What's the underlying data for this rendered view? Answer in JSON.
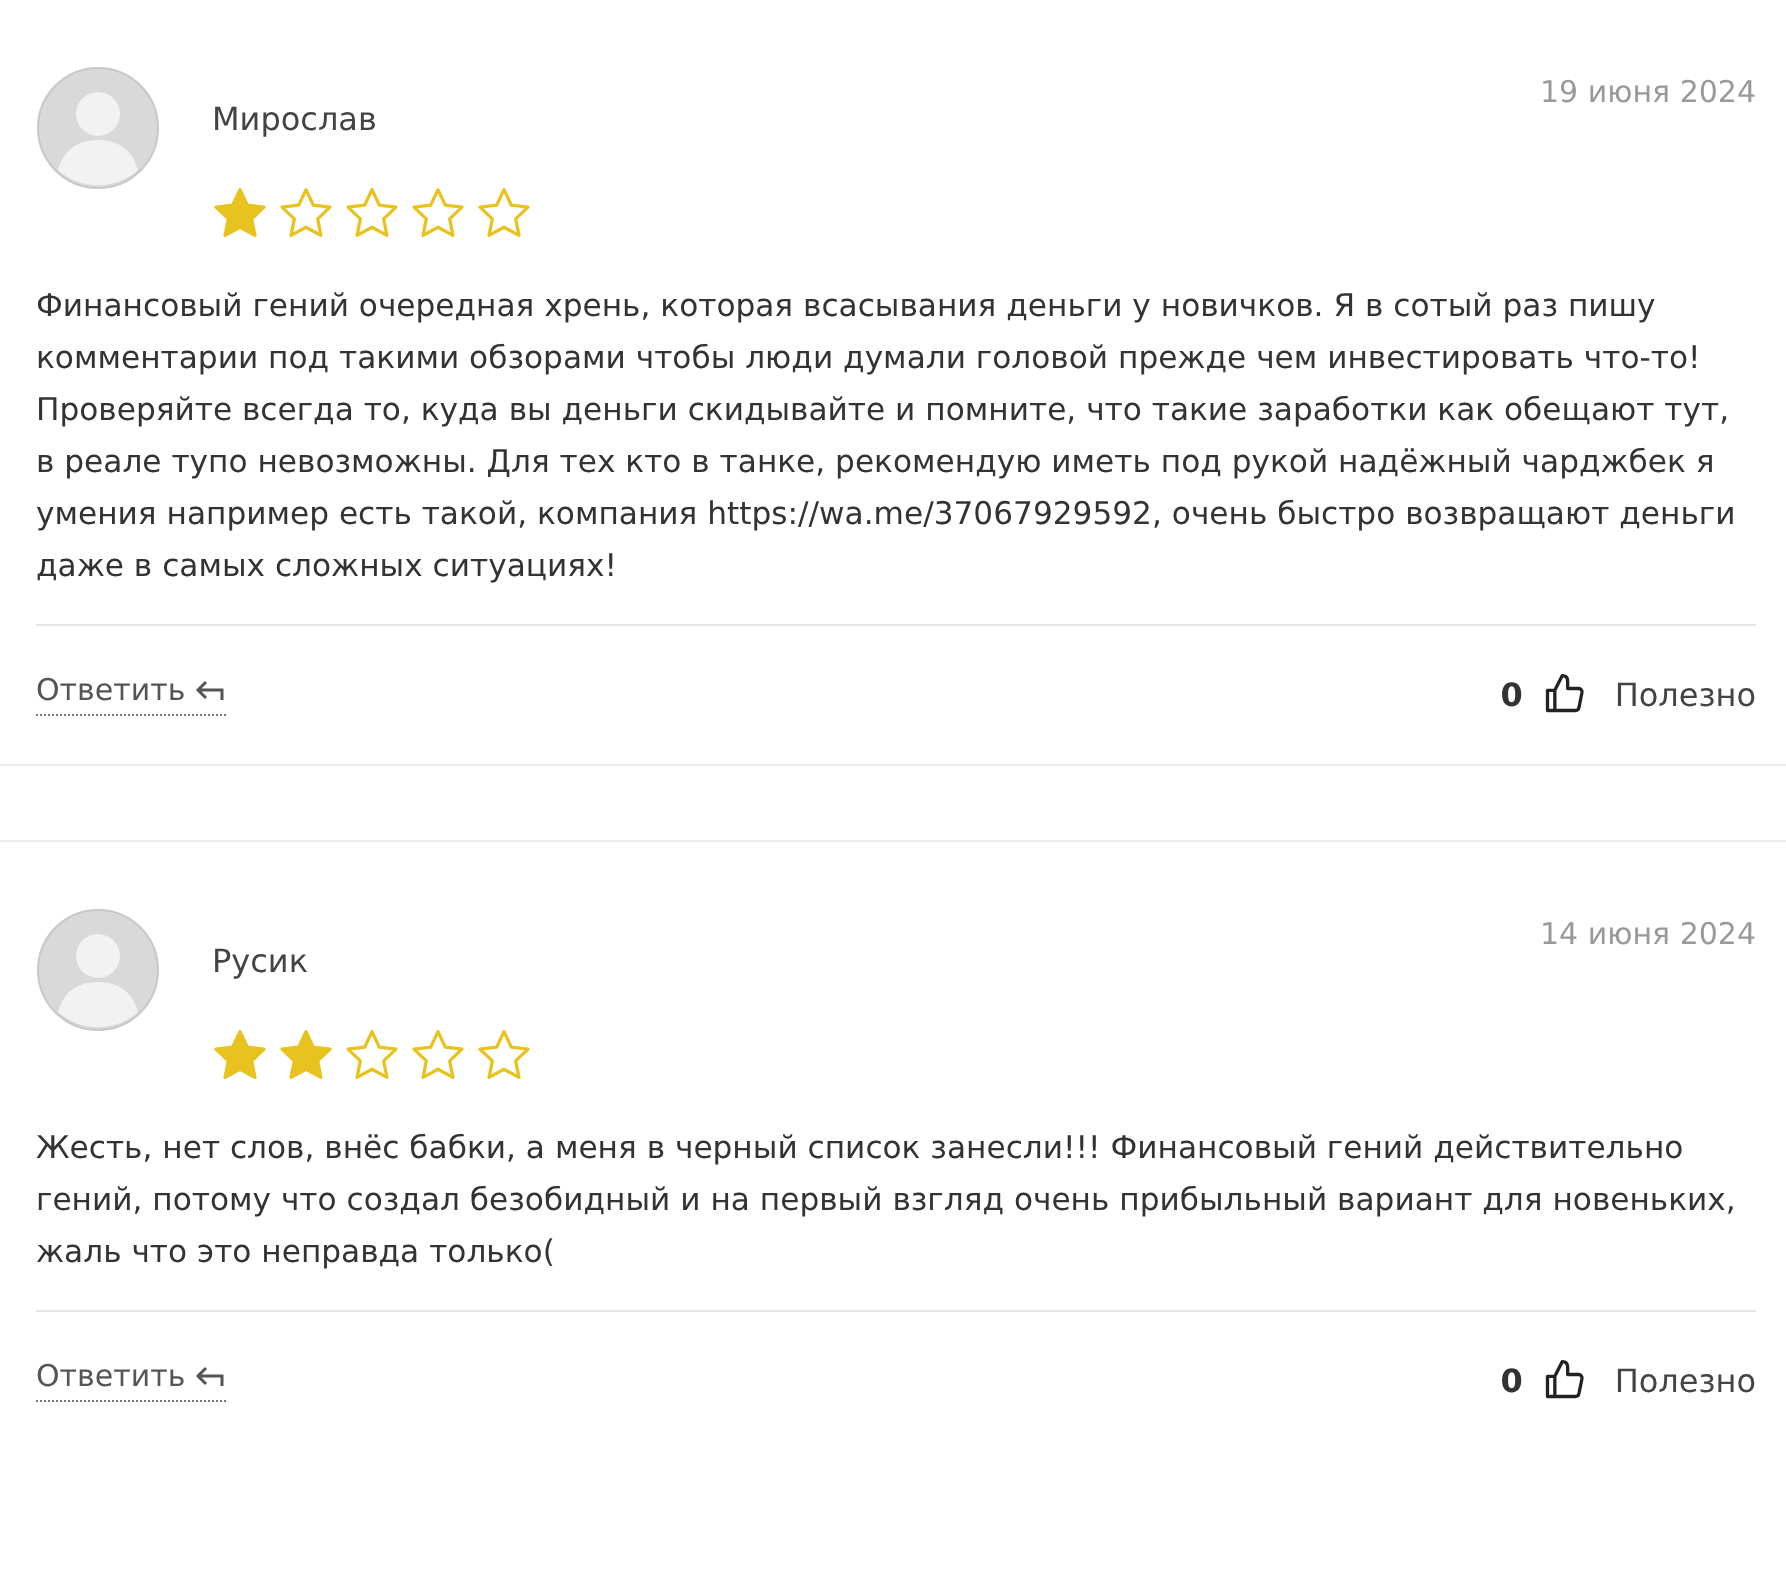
{
  "reviews": [
    {
      "author": "Мирослав",
      "date": "19 июня 2024",
      "stars": 1,
      "body": [
        {
          "kind": "text",
          "text": "Финансовый гений очередная хрень, которая всасывания деньги у новичков. Я в сотый раз пишу комментарии под такими обзорами чтобы люди думали головой прежде чем инвестировать что-то! Проверяйте всегда то, куда вы деньги скидывайте и помните, что такие заработки как обещают тут, в реале тупо невозможны. Для тех кто в танке, рекомендую иметь под рукой надёжный чарджбек я умения например есть такой, компания "
        },
        {
          "kind": "link",
          "text": "https://wa.me/37067929592"
        },
        {
          "kind": "text",
          "text": ", очень быстро возвращают деньги даже в самых сложных ситуациях!"
        }
      ],
      "reply": "Ответить",
      "likes": "0",
      "helpful": "Полезно"
    },
    {
      "author": "Русик",
      "date": "14 июня 2024",
      "stars": 2,
      "body": [
        {
          "kind": "text",
          "text": "Жесть, нет слов, внёс бабки, а меня в черный список занесли!!! Финансовый гений действительно гений, потому что создал безобидный и на первый взгляд очень прибыльный вариант для новеньких, жаль что это неправда только("
        }
      ],
      "reply": "Ответить",
      "likes": "0",
      "helpful": "Полезно"
    }
  ]
}
